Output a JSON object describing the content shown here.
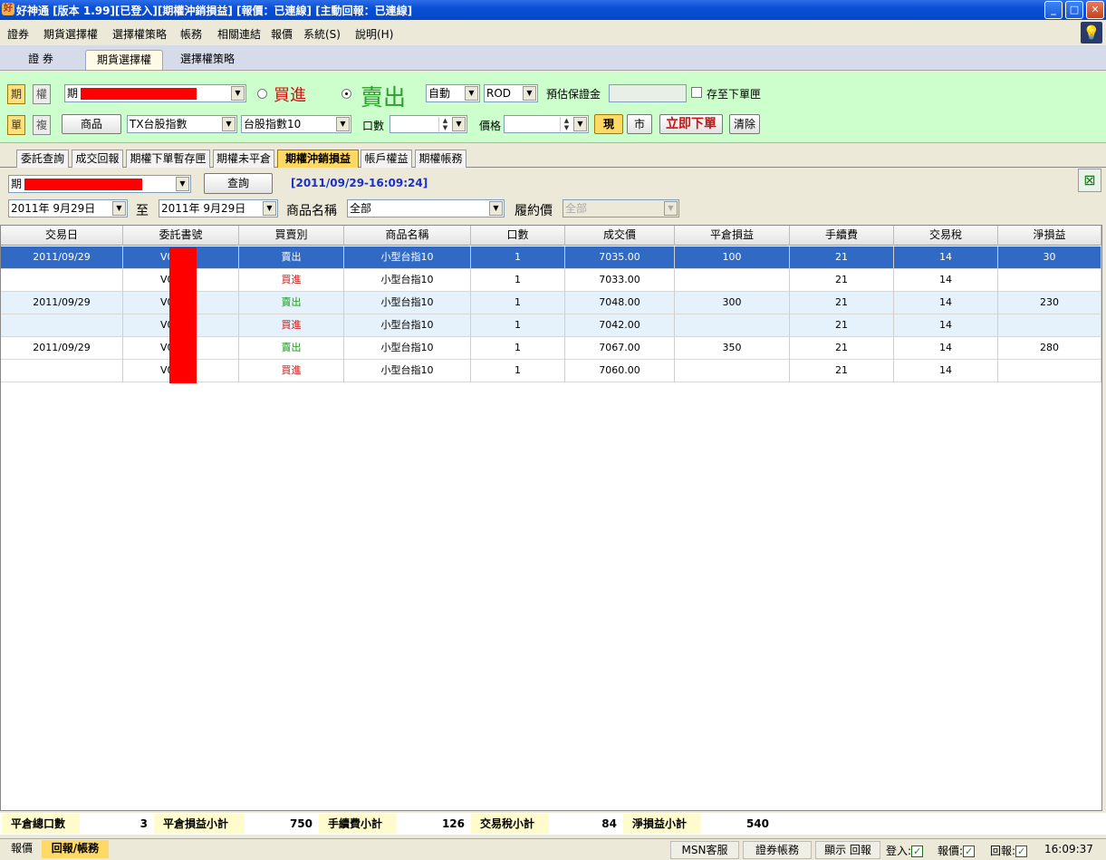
{
  "window": {
    "title": "好神通 [版本 1.99][已登入][期權沖銷損益] [報價：已連線] [主動回報：已連線]"
  },
  "menu": [
    "證券",
    "期貨選擇權",
    "選擇權策略",
    "帳務",
    "相關連結",
    "報價",
    "系統(S)",
    "說明(H)"
  ],
  "top_tabs": [
    "證 券",
    "期貨選擇權",
    "選擇權策略"
  ],
  "order": {
    "type_buttons": [
      "期",
      "權"
    ],
    "order_buttons": [
      "單",
      "複"
    ],
    "account_prefix": "期",
    "buy_label": "買進",
    "sell_label": "賣出",
    "auto_select": "自動",
    "tif_select": "ROD",
    "margin_label": "預估保證金",
    "save_label": "存至下單匣",
    "product_button": "商品",
    "product_select": "TX台股指數",
    "contract_select": "台股指數10",
    "qty_label": "口數",
    "price_label": "價格",
    "now_button": "現",
    "market_button": "市",
    "submit_button": "立即下單",
    "clear_button": "清除"
  },
  "sub_tabs": [
    "委託查詢",
    "成交回報",
    "期權下單暫存匣",
    "期權未平倉",
    "期權沖銷損益",
    "帳戶權益",
    "期權帳務"
  ],
  "query": {
    "account_prefix": "期",
    "query_button": "查詢",
    "timestamp": "[2011/09/29-16:09:24]",
    "date_from": "2011年 9月29日",
    "to_label": "至",
    "date_to": "2011年 9月29日",
    "product_name_label": "商品名稱",
    "product_name_value": "全部",
    "strike_label": "履約價",
    "strike_value": "全部"
  },
  "table": {
    "columns": [
      "交易日",
      "委託書號",
      "買賣別",
      "商品名稱",
      "口數",
      "成交價",
      "平倉損益",
      "手續費",
      "交易稅",
      "淨損益"
    ],
    "rows": [
      {
        "date": "2011/09/29",
        "order_no": "V0",
        "side": "賣出",
        "product": "小型台指10",
        "qty": "1",
        "price": "7035.00",
        "close_pl": "100",
        "fee": "21",
        "tax": "14",
        "net": "30"
      },
      {
        "date": "",
        "order_no": "V0",
        "side": "買進",
        "product": "小型台指10",
        "qty": "1",
        "price": "7033.00",
        "close_pl": "",
        "fee": "21",
        "tax": "14",
        "net": ""
      },
      {
        "date": "2011/09/29",
        "order_no": "V0",
        "side": "賣出",
        "product": "小型台指10",
        "qty": "1",
        "price": "7048.00",
        "close_pl": "300",
        "fee": "21",
        "tax": "14",
        "net": "230"
      },
      {
        "date": "",
        "order_no": "V0",
        "side": "買進",
        "product": "小型台指10",
        "qty": "1",
        "price": "7042.00",
        "close_pl": "",
        "fee": "21",
        "tax": "14",
        "net": ""
      },
      {
        "date": "2011/09/29",
        "order_no": "V0",
        "side": "賣出",
        "product": "小型台指10",
        "qty": "1",
        "price": "7067.00",
        "close_pl": "350",
        "fee": "21",
        "tax": "14",
        "net": "280"
      },
      {
        "date": "",
        "order_no": "V0",
        "side": "買進",
        "product": "小型台指10",
        "qty": "1",
        "price": "7060.00",
        "close_pl": "",
        "fee": "21",
        "tax": "14",
        "net": ""
      }
    ]
  },
  "summary": {
    "total_qty_label": "平倉總口數",
    "total_qty": "3",
    "close_pl_label": "平倉損益小計",
    "close_pl": "750",
    "fee_label": "手續費小計",
    "fee": "126",
    "tax_label": "交易稅小計",
    "tax": "84",
    "net_label": "淨損益小計",
    "net": "540"
  },
  "status": {
    "tabs": [
      "報價",
      "回報/帳務"
    ],
    "msn": "MSN客服",
    "stock_acct": "證券帳務",
    "show_report": "顯示 回報",
    "login": "登入:",
    "quote": "報價:",
    "report": "回報:",
    "time": "16:09:37"
  }
}
